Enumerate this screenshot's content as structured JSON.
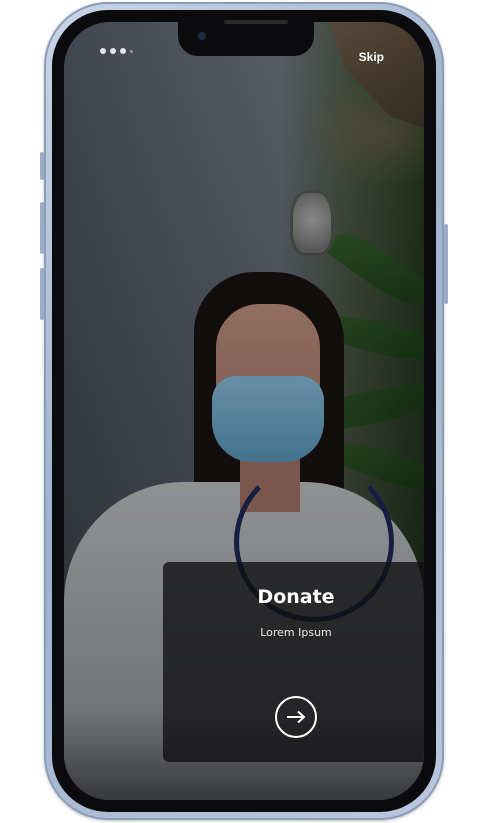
{
  "status_bar": {
    "dots_icon": "signal-dots-icon"
  },
  "header": {
    "skip_label": "Skip"
  },
  "onboarding": {
    "title": "Donate",
    "subtitle": "Lorem Ipsum",
    "next_icon": "arrow-right-icon"
  },
  "colors": {
    "card_background": "#0f0f12",
    "text_primary": "#ffffff",
    "device_frame": "#b9c8de"
  }
}
